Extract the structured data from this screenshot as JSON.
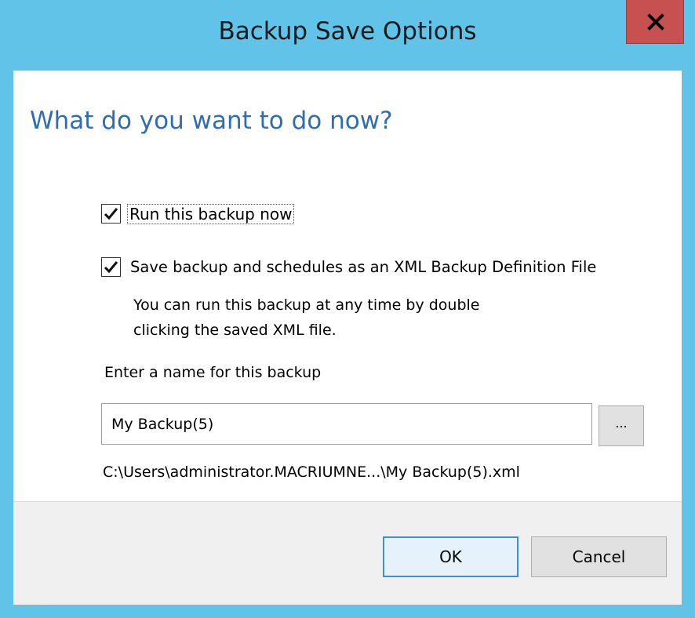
{
  "window": {
    "title": "Backup Save Options",
    "close_label": "X"
  },
  "content": {
    "heading": "What do you want to do now?",
    "options": [
      {
        "label": "Run this backup now",
        "checked": true
      },
      {
        "label": "Save backup and schedules as an XML Backup Definition File",
        "checked": true
      }
    ],
    "description_line1": "You can run this backup at any time by double",
    "description_line2": "clicking the saved XML file.",
    "name_label": "Enter a name for this backup",
    "name_value": "My Backup(5)",
    "browse_label": "...",
    "path": "C:\\Users\\administrator.MACRIUMNE...\\My Backup(5).xml"
  },
  "footer": {
    "ok_label": "OK",
    "cancel_label": "Cancel"
  },
  "colors": {
    "titlebar": "#62c3e8",
    "close_button": "#c75050",
    "heading": "#2e6db4",
    "ok_border": "#3c8fd4"
  }
}
